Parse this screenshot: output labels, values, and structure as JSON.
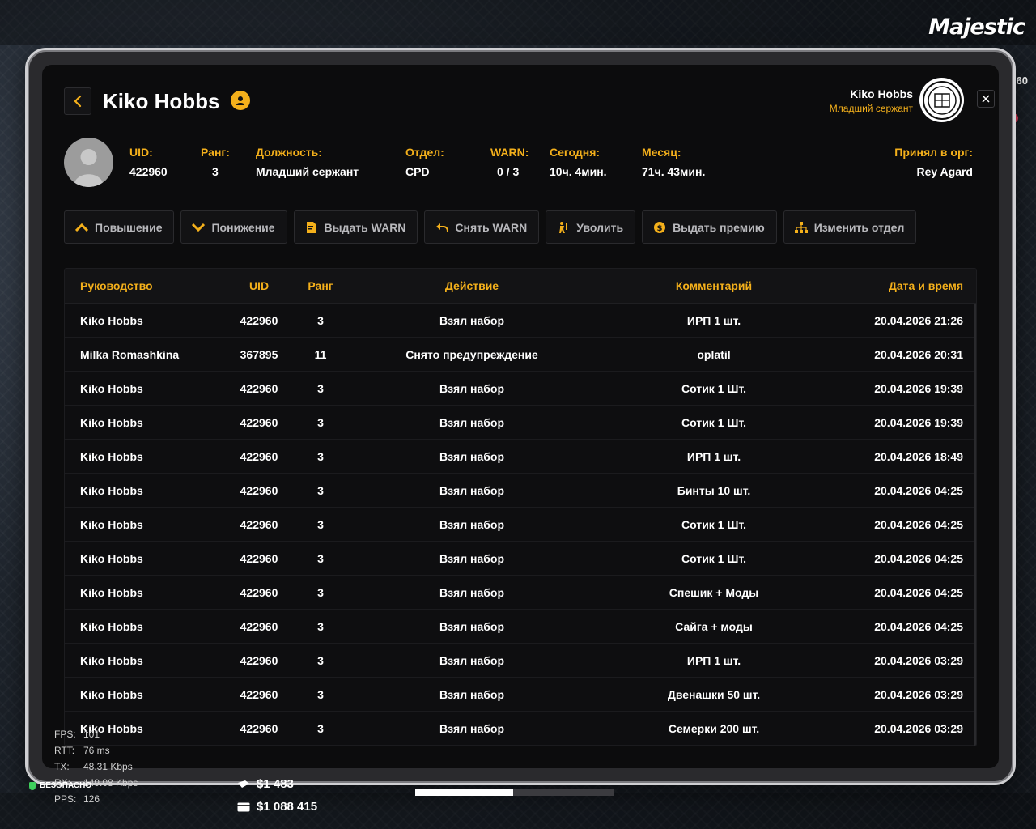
{
  "brand": "Majestic",
  "side_number": "60",
  "header": {
    "title": "Kiko Hobbs",
    "officer_name": "Kiko Hobbs",
    "officer_rank": "Младший сержант"
  },
  "info": [
    {
      "label": "UID:",
      "value": "422960"
    },
    {
      "label": "Ранг:",
      "value": "3"
    },
    {
      "label": "Должность:",
      "value": "Младший сержант"
    },
    {
      "label": "Отдел:",
      "value": "CPD"
    },
    {
      "label": "WARN:",
      "value": "0 / 3"
    },
    {
      "label": "Сегодня:",
      "value": "10ч. 4мин."
    },
    {
      "label": "Месяц:",
      "value": "71ч. 43мин."
    },
    {
      "label": "Принял в орг:",
      "value": "Rey Agard"
    }
  ],
  "actions": [
    {
      "label": "Повышение",
      "icon": "chevron-up-icon"
    },
    {
      "label": "Понижение",
      "icon": "chevron-down-icon"
    },
    {
      "label": "Выдать WARN",
      "icon": "document-warn-icon"
    },
    {
      "label": "Снять WARN",
      "icon": "undo-icon"
    },
    {
      "label": "Уволить",
      "icon": "fire-person-icon"
    },
    {
      "label": "Выдать премию",
      "icon": "coin-icon"
    },
    {
      "label": "Изменить отдел",
      "icon": "org-chart-icon"
    }
  ],
  "table": {
    "headers": [
      "Руководство",
      "UID",
      "Ранг",
      "Действие",
      "Комментарий",
      "Дата и время"
    ],
    "rows": [
      [
        "Kiko Hobbs",
        "422960",
        "3",
        "Взял набор",
        "ИРП 1 шт.",
        "20.04.2026 21:26"
      ],
      [
        "Milka Romashkina",
        "367895",
        "11",
        "Снято предупреждение",
        "oplatil",
        "20.04.2026 20:31"
      ],
      [
        "Kiko Hobbs",
        "422960",
        "3",
        "Взял набор",
        "Сотик 1 Шт.",
        "20.04.2026 19:39"
      ],
      [
        "Kiko Hobbs",
        "422960",
        "3",
        "Взял набор",
        "Сотик 1 Шт.",
        "20.04.2026 19:39"
      ],
      [
        "Kiko Hobbs",
        "422960",
        "3",
        "Взял набор",
        "ИРП 1 шт.",
        "20.04.2026 18:49"
      ],
      [
        "Kiko Hobbs",
        "422960",
        "3",
        "Взял набор",
        "Бинты 10 шт.",
        "20.04.2026 04:25"
      ],
      [
        "Kiko Hobbs",
        "422960",
        "3",
        "Взял набор",
        "Сотик 1 Шт.",
        "20.04.2026 04:25"
      ],
      [
        "Kiko Hobbs",
        "422960",
        "3",
        "Взял набор",
        "Сотик 1 Шт.",
        "20.04.2026 04:25"
      ],
      [
        "Kiko Hobbs",
        "422960",
        "3",
        "Взял набор",
        "Спешик + Моды",
        "20.04.2026 04:25"
      ],
      [
        "Kiko Hobbs",
        "422960",
        "3",
        "Взял набор",
        "Сайга + моды",
        "20.04.2026 04:25"
      ],
      [
        "Kiko Hobbs",
        "422960",
        "3",
        "Взял набор",
        "ИРП 1 шт.",
        "20.04.2026 03:29"
      ],
      [
        "Kiko Hobbs",
        "422960",
        "3",
        "Взял набор",
        "Двенашки 50 шт.",
        "20.04.2026 03:29"
      ],
      [
        "Kiko Hobbs",
        "422960",
        "3",
        "Взял набор",
        "Семерки 200 шт.",
        "20.04.2026 03:29"
      ]
    ]
  },
  "hud": {
    "netstats": [
      {
        "k": "FPS:",
        "v": "101"
      },
      {
        "k": "RTT:",
        "v": "76 ms"
      },
      {
        "k": "TX:",
        "v": "48.31 Kbps"
      },
      {
        "k": "RX:",
        "v": "149.08 Kbps"
      },
      {
        "k": "PPS:",
        "v": "126"
      }
    ],
    "secure_label": "БЕЗОПАСНО",
    "cash": "$1 483",
    "bank": "$1 088 415",
    "progress": 0.49
  },
  "colors": {
    "accent": "#f4b01b",
    "panel": "#0c0c0d"
  }
}
